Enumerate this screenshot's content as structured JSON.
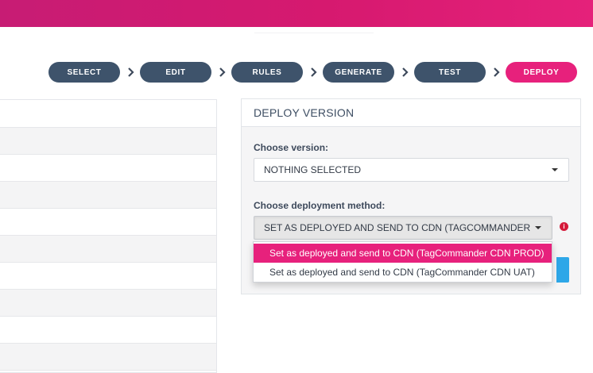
{
  "stepper": {
    "steps": [
      "SELECT",
      "EDIT",
      "RULES",
      "GENERATE",
      "TEST",
      "DEPLOY"
    ],
    "active": "DEPLOY",
    "active_color": "#e7217c",
    "inactive_color": "#3e536b"
  },
  "panel": {
    "title": "DEPLOY VERSION",
    "version_label": "Choose version:",
    "version_value": "NOTHING SELECTED",
    "method_label": "Choose deployment method:",
    "method_value": "SET AS DEPLOYED AND SEND TO CDN (TAGCOMMANDER",
    "info_icon": "info-icon",
    "dropdown_options": [
      "Set as deployed and send to CDN (TagCommander CDN PROD)",
      "Set as deployed and send to CDN (TagCommander CDN UAT)"
    ],
    "highlight_color": "#e7217c",
    "button_color": "#2ea7e8"
  }
}
